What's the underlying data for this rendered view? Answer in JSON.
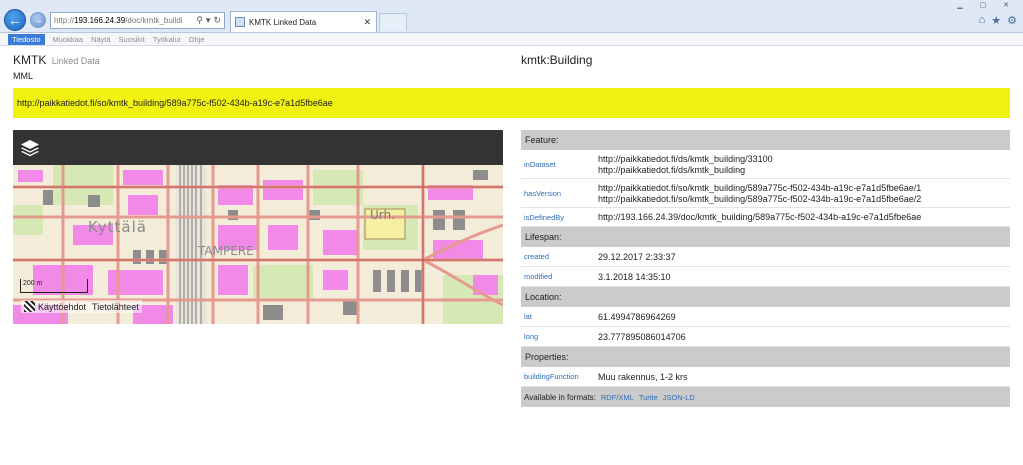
{
  "browser": {
    "address": {
      "lead": "http://",
      "host": "193.166.24.39",
      "rest": "/doc/kmtk_buildi"
    },
    "tab_title": "KMTK Linked Data"
  },
  "menu": [
    "Tiedosto",
    "Muokkaa",
    "Näytä",
    "Suosikit",
    "Työkalut",
    "Ohje"
  ],
  "header": {
    "brand": "KMTK",
    "brand_sub": "Linked Data",
    "org": "MML",
    "resource_type": "kmtk:Building"
  },
  "resource_uri": "http://paikkatiedot.fi/so/kmtk_building/589a775c-f502-434b-a19c-e7a1d5fbe6ae",
  "map": {
    "labels": {
      "kyttala": "Kyttälä",
      "tampere": "TAMPERE",
      "urh": "Urh."
    },
    "scale": "200 m",
    "attribution": {
      "left": "Käyttöehdot",
      "right": "Tietolähteet"
    }
  },
  "properties": {
    "feature_header": "Feature:",
    "inDataset": {
      "name": "inDataset",
      "values": [
        "http://paikkatiedot.fi/ds/kmtk_building/33100",
        "http://paikkatiedot.fi/ds/kmtk_building"
      ]
    },
    "hasVersion": {
      "name": "hasVersion",
      "values": [
        "http://paikkatiedot.fi/so/kmtk_building/589a775c-f502-434b-a19c-e7a1d5fbe6ae/1",
        "http://paikkatiedot.fi/so/kmtk_building/589a775c-f502-434b-a19c-e7a1d5fbe6ae/2"
      ]
    },
    "isDefinedBy": {
      "name": "isDefinedBy",
      "value": "http://193.166.24.39/doc/kmtk_building/589a775c-f502-434b-a19c-e7a1d5fbe6ae"
    },
    "lifespan_header": "Lifespan:",
    "created": {
      "name": "created",
      "value": "29.12.2017 2:33:37"
    },
    "modified": {
      "name": "modified",
      "value": "3.1.2018 14:35:10"
    },
    "location_header": "Location:",
    "lat": {
      "name": "lat",
      "value": "61.4994786964269"
    },
    "long": {
      "name": "long",
      "value": "23.777895086014706"
    },
    "properties_header": "Properties:",
    "buildingFunction": {
      "name": "buildingFunction",
      "value": "Muu rakennus, 1-2 krs"
    }
  },
  "formats": {
    "label": "Available in formats:",
    "links": [
      "RDF/XML",
      "Turtle",
      "JSON-LD"
    ]
  }
}
